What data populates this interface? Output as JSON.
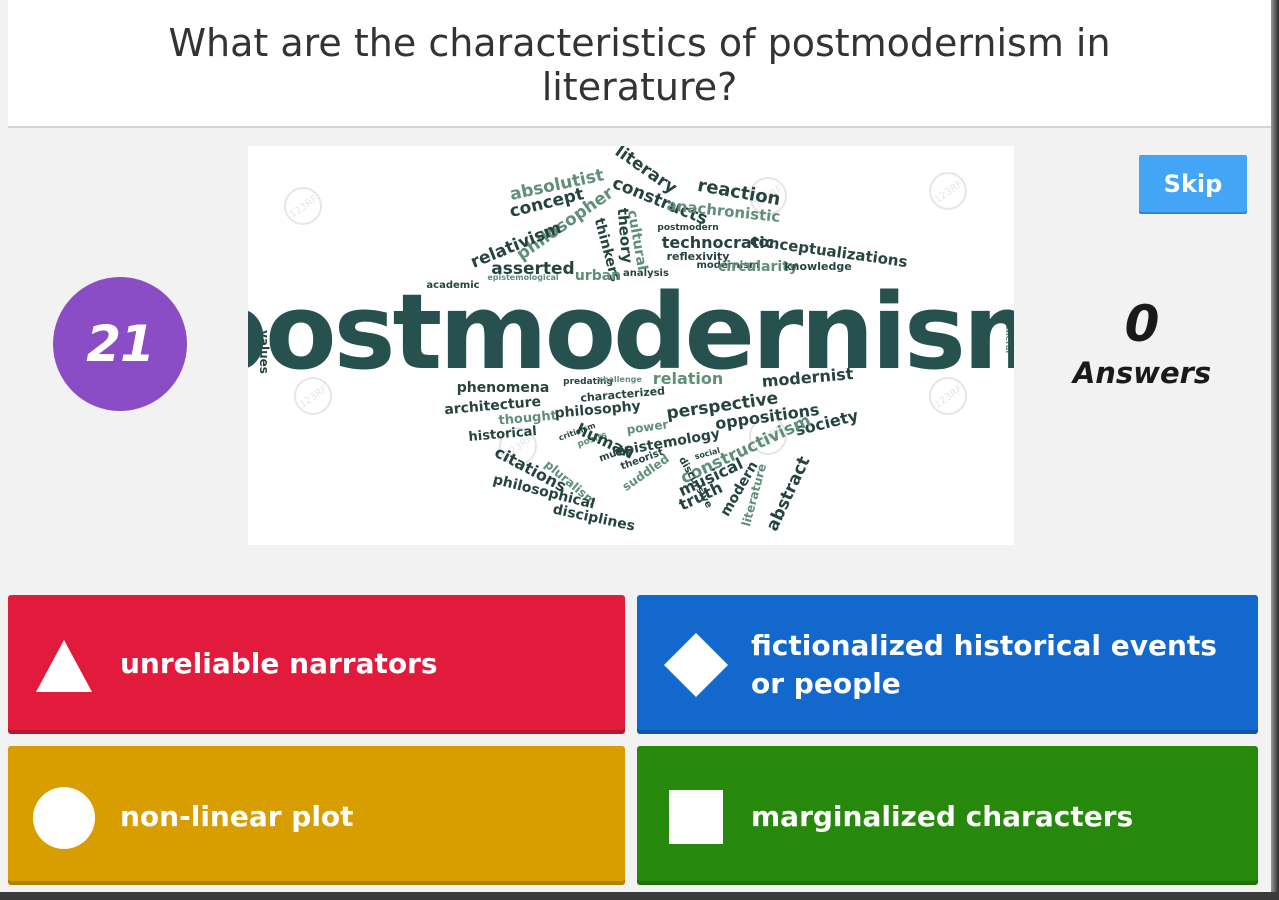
{
  "question": {
    "text": "What are the characteristics of postmodernism in literature?"
  },
  "timer": {
    "value": "21",
    "color": "#8a4dc5"
  },
  "skip_button": {
    "label": "Skip",
    "color": "#42a5f5"
  },
  "answers_count": {
    "number": "0",
    "label": "Answers"
  },
  "media": {
    "main_word": "postmodernism",
    "words": [
      "absolutist",
      "concept",
      "literary",
      "reaction",
      "constructs",
      "anachronistic",
      "philosopher",
      "relativism",
      "theory",
      "cultural",
      "thinkers",
      "postmodern",
      "technocratic",
      "conceptualizations",
      "reflexivity",
      "modernism",
      "asserted",
      "circularity",
      "knowledge",
      "analysis",
      "academic",
      "epistemological",
      "urban",
      "values",
      "general",
      "phenomena",
      "predating",
      "challenge",
      "relation",
      "modernist",
      "characterized",
      "architecture",
      "philosophy",
      "perspective",
      "oppositions",
      "thought",
      "power",
      "historical",
      "epistemology",
      "society",
      "criticism",
      "posits",
      "music",
      "theorist",
      "social",
      "constructivism",
      "human",
      "suddled",
      "discursive",
      "musical",
      "modern",
      "literature",
      "abstract",
      "citations",
      "pluralism",
      "truth",
      "philosophical",
      "disciplines"
    ],
    "watermark": "123RF"
  },
  "answers": [
    {
      "shape": "triangle",
      "label": "unreliable narrators",
      "color": "#e21b3c"
    },
    {
      "shape": "diamond",
      "label": "fictionalized historical events or people",
      "color": "#1368ce"
    },
    {
      "shape": "circle",
      "label": "non-linear plot",
      "color": "#d89e00"
    },
    {
      "shape": "square",
      "label": "marginalized characters",
      "color": "#26890c"
    }
  ]
}
